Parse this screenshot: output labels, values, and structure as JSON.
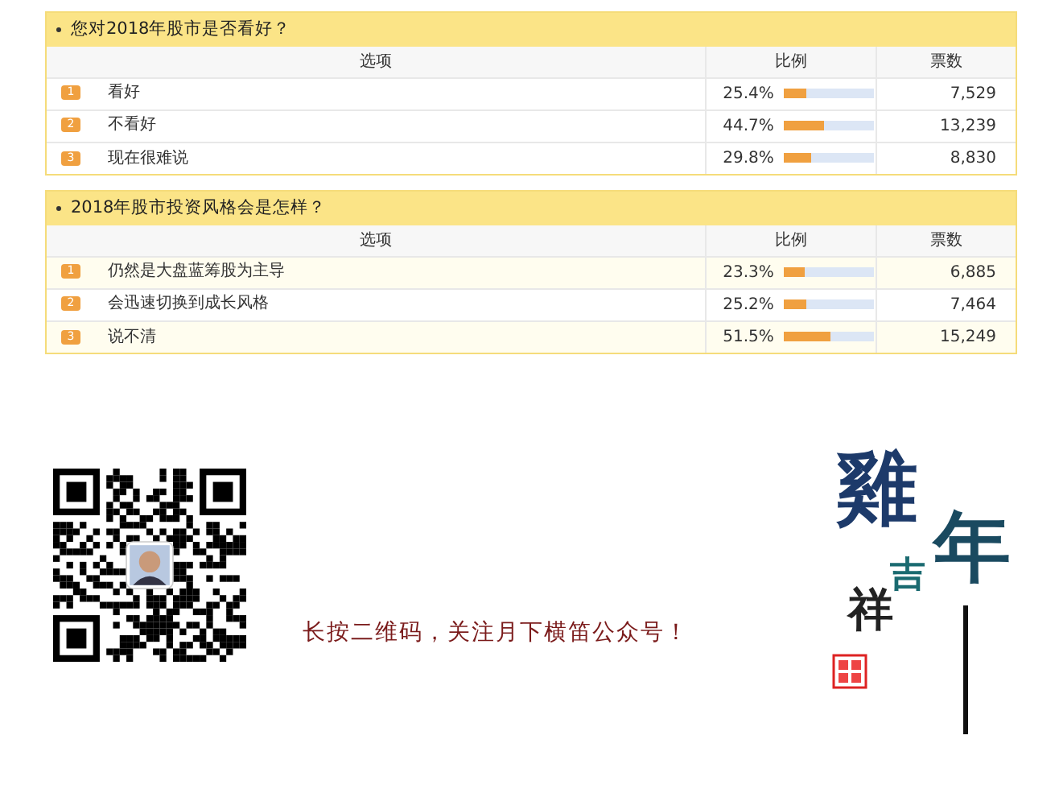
{
  "polls": [
    {
      "question": "您对2018年股市是否看好？",
      "columns": [
        "选项",
        "比例",
        "票数"
      ],
      "rows": [
        {
          "number": "1",
          "option": "看好",
          "percent": "25.4%",
          "level": 0.254,
          "votes": "7,529"
        },
        {
          "number": "2",
          "option": "不看好",
          "percent": "44.7%",
          "level": 0.447,
          "votes": "13,239"
        },
        {
          "number": "3",
          "option": "现在很难说",
          "percent": "29.8%",
          "level": 0.298,
          "votes": "8,830"
        }
      ]
    },
    {
      "question": "2018年股市投资风格会是怎样？",
      "columns": [
        "选项",
        "比例",
        "票数"
      ],
      "rows": [
        {
          "number": "1",
          "option": "仍然是大盘蓝筹股为主导",
          "percent": "23.3%",
          "level": 0.233,
          "votes": "6,885"
        },
        {
          "number": "2",
          "option": "会迅速切换到成长风格",
          "percent": "25.2%",
          "level": 0.252,
          "votes": "7,464"
        },
        {
          "number": "3",
          "option": "说不清",
          "percent": "51.5%",
          "level": 0.515,
          "votes": "15,249"
        }
      ]
    }
  ],
  "caption": "长按二维码，关注月下横笛公众号！",
  "calligraphy": [
    "雞",
    "吉",
    "祥",
    "年"
  ]
}
